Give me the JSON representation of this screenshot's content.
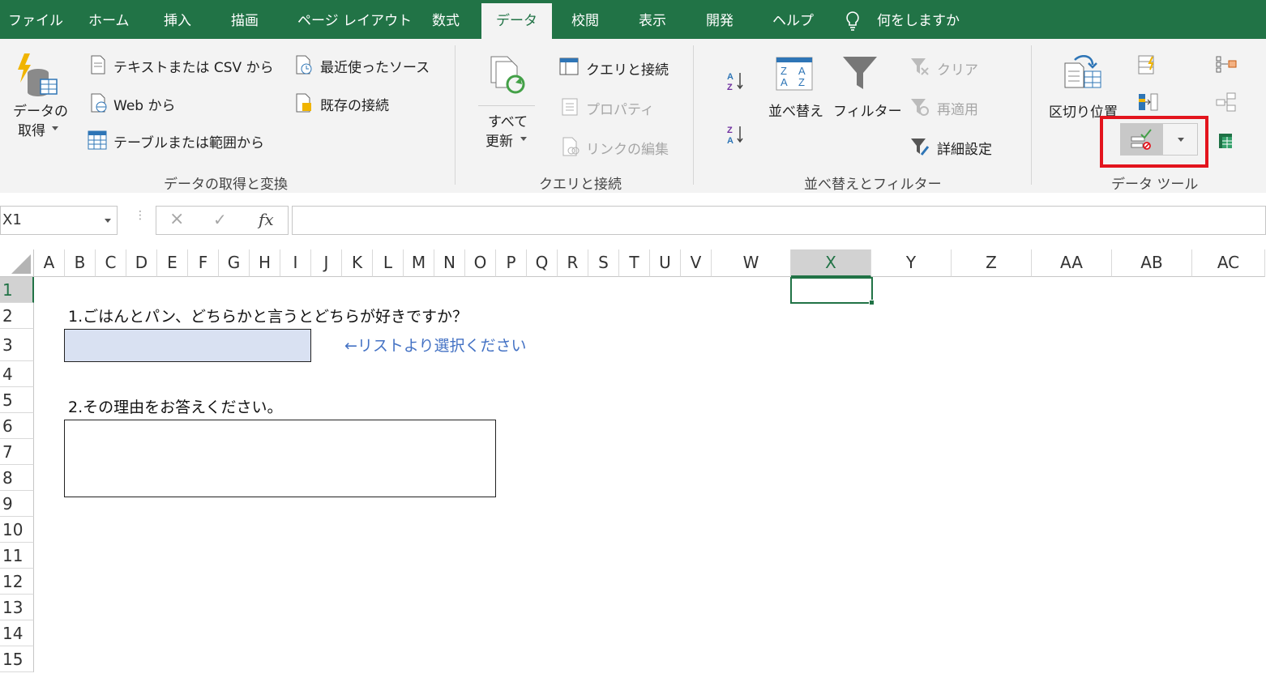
{
  "tabs": [
    {
      "label": "ファイル"
    },
    {
      "label": "ホーム"
    },
    {
      "label": "挿入"
    },
    {
      "label": "描画"
    },
    {
      "label": "ページ レイアウト"
    },
    {
      "label": "数式"
    },
    {
      "label": "データ",
      "active": true
    },
    {
      "label": "校閲"
    },
    {
      "label": "表示"
    },
    {
      "label": "開発"
    },
    {
      "label": "ヘルプ"
    }
  ],
  "tell_me": "何をしますか",
  "ribbon": {
    "get_data": {
      "line1": "データの",
      "line2": "取得"
    },
    "from_text_csv": "テキストまたは CSV から",
    "from_web": "Web から",
    "from_table": "テーブルまたは範囲から",
    "recent_sources": "最近使ったソース",
    "existing_connections": "既存の接続",
    "group_get_transform": "データの取得と変換",
    "refresh_all": {
      "line1": "すべて",
      "line2": "更新"
    },
    "queries_connections": "クエリと接続",
    "properties": "プロパティ",
    "edit_links": "リンクの編集",
    "group_queries": "クエリと接続",
    "sort": "並べ替え",
    "filter": "フィルター",
    "clear": "クリア",
    "reapply": "再適用",
    "advanced": "詳細設定",
    "group_sort_filter": "並べ替えとフィルター",
    "text_to_columns": "区切り位置",
    "group_data_tools": "データ ツール"
  },
  "formula_bar": {
    "name_box": "X1",
    "cancel_icon": "×",
    "enter_icon": "✓",
    "fx_label": "fx",
    "formula": ""
  },
  "columns": [
    "A",
    "B",
    "C",
    "D",
    "E",
    "F",
    "G",
    "H",
    "I",
    "J",
    "K",
    "L",
    "M",
    "N",
    "O",
    "P",
    "Q",
    "R",
    "S",
    "T",
    "U",
    "V",
    "W",
    "X",
    "Y",
    "Z",
    "AA",
    "AB",
    "AC"
  ],
  "rows": [
    "1",
    "2",
    "3",
    "4",
    "5",
    "6",
    "7",
    "8",
    "9",
    "10",
    "11",
    "12",
    "13",
    "14",
    "15"
  ],
  "selected_column": "X",
  "selected_row": "1",
  "sheet": {
    "q1": "1.ごはんとパン、どちらかと言うとどちらが好きですか？",
    "q1_hint": "←リストより選択ください",
    "q1_answer": "",
    "q2": "2.その理由をお答えください。",
    "q2_answer": ""
  },
  "colors": {
    "accent": "#217346",
    "highlight_box": "#e3141d",
    "hint_text": "#4472c4",
    "answer_fill": "#d9e1f2"
  }
}
